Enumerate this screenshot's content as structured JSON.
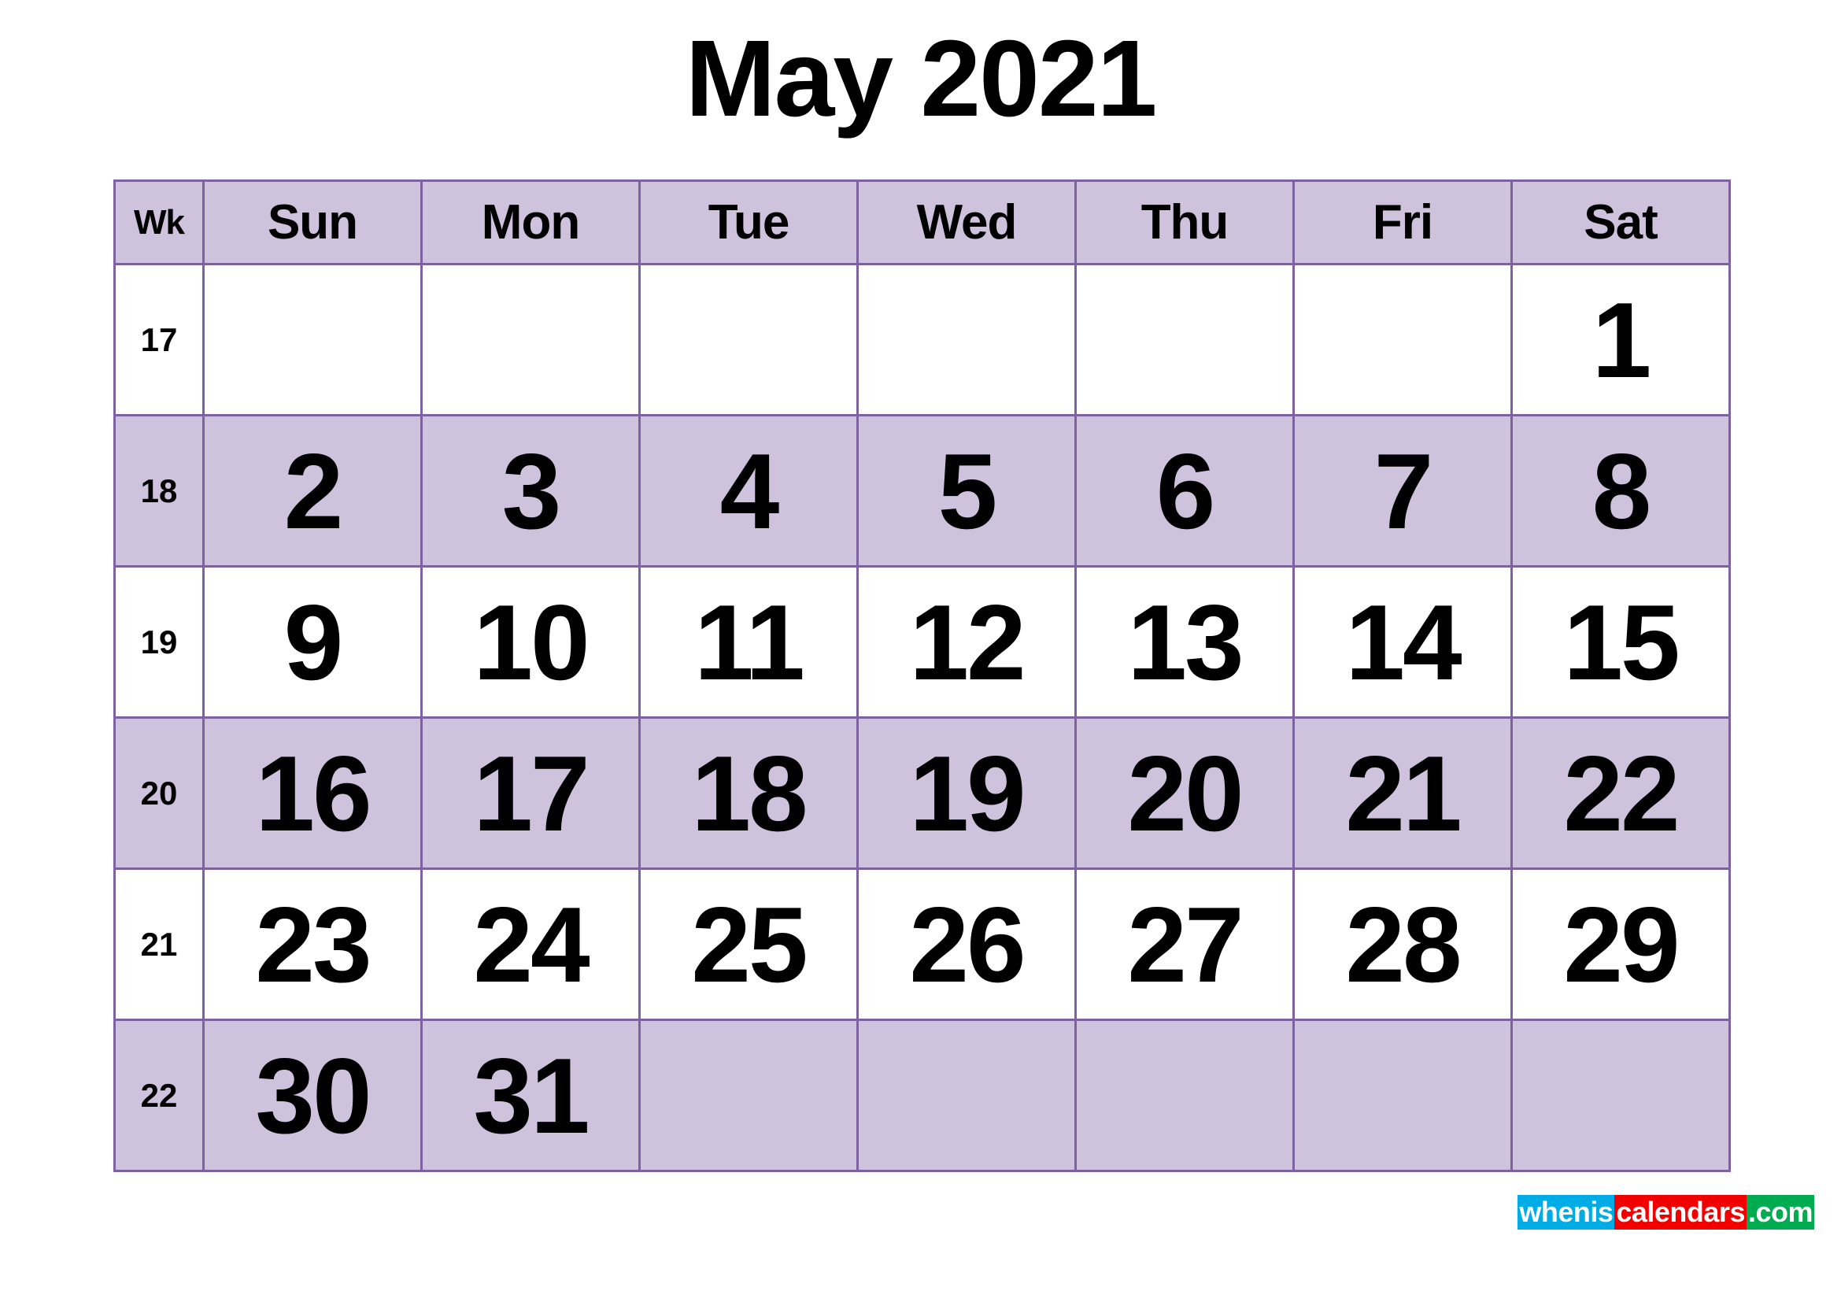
{
  "title": "May 2021",
  "colors": {
    "tint": "#cec2dd",
    "border": "#7d62a0",
    "text": "#000000",
    "background": "#ffffff",
    "watermark_blue": "#00ace6",
    "watermark_red": "#f20000",
    "watermark_green": "#00ac4f"
  },
  "table": {
    "week_header": "Wk",
    "day_headers": [
      "Sun",
      "Mon",
      "Tue",
      "Wed",
      "Thu",
      "Fri",
      "Sat"
    ],
    "rows": [
      {
        "week": "17",
        "shaded": false,
        "days": [
          "",
          "",
          "",
          "",
          "",
          "",
          "1"
        ]
      },
      {
        "week": "18",
        "shaded": true,
        "days": [
          "2",
          "3",
          "4",
          "5",
          "6",
          "7",
          "8"
        ]
      },
      {
        "week": "19",
        "shaded": false,
        "days": [
          "9",
          "10",
          "11",
          "12",
          "13",
          "14",
          "15"
        ]
      },
      {
        "week": "20",
        "shaded": true,
        "days": [
          "16",
          "17",
          "18",
          "19",
          "20",
          "21",
          "22"
        ]
      },
      {
        "week": "21",
        "shaded": false,
        "days": [
          "23",
          "24",
          "25",
          "26",
          "27",
          "28",
          "29"
        ]
      },
      {
        "week": "22",
        "shaded": true,
        "days": [
          "30",
          "31",
          "",
          "",
          "",
          "",
          ""
        ]
      }
    ]
  },
  "watermark": {
    "part1": "whenis",
    "part2": "calendars",
    "part3": ".com"
  }
}
